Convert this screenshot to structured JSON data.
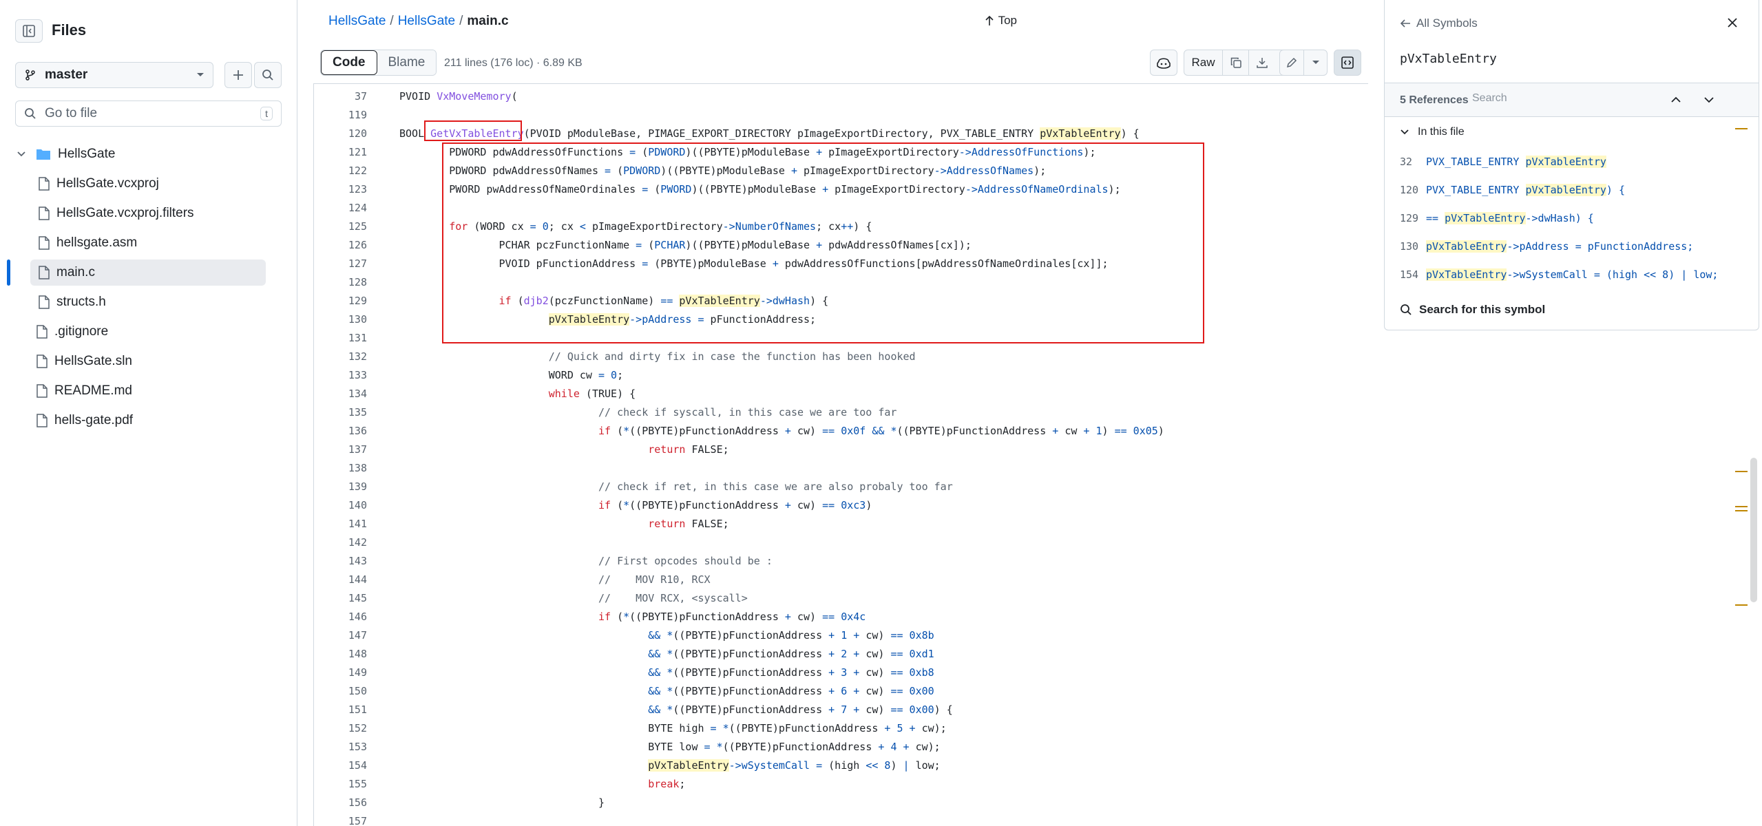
{
  "sidebar": {
    "title": "Files",
    "branch": "master",
    "goto_placeholder": "Go to file",
    "goto_shortcut": "t",
    "tree": [
      {
        "label": "HellsGate",
        "type": "folder"
      },
      {
        "label": "HellsGate.vcxproj",
        "type": "file"
      },
      {
        "label": "HellsGate.vcxproj.filters",
        "type": "file"
      },
      {
        "label": "hellsgate.asm",
        "type": "file"
      },
      {
        "label": "main.c",
        "type": "file"
      },
      {
        "label": "structs.h",
        "type": "file"
      },
      {
        "label": ".gitignore",
        "type": "file"
      },
      {
        "label": "HellsGate.sln",
        "type": "file"
      },
      {
        "label": "README.md",
        "type": "file"
      },
      {
        "label": "hells-gate.pdf",
        "type": "file"
      }
    ]
  },
  "header": {
    "breadcrumb": [
      "HellsGate",
      "HellsGate",
      "main.c"
    ],
    "top_label": "Top"
  },
  "toolbar": {
    "code_tab": "Code",
    "blame_tab": "Blame",
    "file_info": "211 lines (176 loc) · 6.89 KB",
    "raw_label": "Raw"
  },
  "code_lines": [
    {
      "n": "37",
      "html": "PVOID <span class=\"fn\">VxMoveMemory</span>("
    },
    {
      "n": "119",
      "html": ""
    },
    {
      "n": "120",
      "html": "BOOL <span class=\"fn\">GetVxTableEntry</span>(PVOID pModuleBase, PIMAGE_EXPORT_DIRECTORY pImageExportDirectory, PVX_TABLE_ENTRY <span class=\"hl\">pVxTableEntry</span>) {"
    },
    {
      "n": "121",
      "html": "        PDWORD pdwAddressOfFunctions <span class=\"op\">=</span> (<span class=\"ty\">PDWORD</span>)((PBYTE)pModuleBase <span class=\"op\">+</span> pImageExportDirectory<span class=\"op\">-></span><span class=\"ty\">AddressOfFunctions</span>);"
    },
    {
      "n": "122",
      "html": "        PDWORD pdwAddressOfNames <span class=\"op\">=</span> (<span class=\"ty\">PDWORD</span>)((PBYTE)pModuleBase <span class=\"op\">+</span> pImageExportDirectory<span class=\"op\">-></span><span class=\"ty\">AddressOfNames</span>);"
    },
    {
      "n": "123",
      "html": "        PWORD pwAddressOfNameOrdinales <span class=\"op\">=</span> (<span class=\"ty\">PWORD</span>)((PBYTE)pModuleBase <span class=\"op\">+</span> pImageExportDirectory<span class=\"op\">-></span><span class=\"ty\">AddressOfNameOrdinals</span>);"
    },
    {
      "n": "124",
      "html": ""
    },
    {
      "n": "125",
      "html": "        <span class=\"kw\">for</span> (WORD cx <span class=\"op\">=</span> <span class=\"nm\">0</span>; cx <span class=\"op\">&lt;</span> pImageExportDirectory<span class=\"op\">-></span><span class=\"ty\">NumberOfNames</span>; cx<span class=\"op\">++</span>) {"
    },
    {
      "n": "126",
      "html": "                PCHAR pczFunctionName <span class=\"op\">=</span> (<span class=\"ty\">PCHAR</span>)((PBYTE)pModuleBase <span class=\"op\">+</span> pdwAddressOfNames[cx]);"
    },
    {
      "n": "127",
      "html": "                PVOID pFunctionAddress <span class=\"op\">=</span> (PBYTE)pModuleBase <span class=\"op\">+</span> pdwAddressOfFunctions[pwAddressOfNameOrdinales[cx]];"
    },
    {
      "n": "128",
      "html": ""
    },
    {
      "n": "129",
      "html": "                <span class=\"kw\">if</span> (<span class=\"fn\">djb2</span>(pczFunctionName) <span class=\"op\">==</span> <span class=\"hl\">pVxTableEntry</span><span class=\"op\">-></span><span class=\"ty\">dwHash</span>) {"
    },
    {
      "n": "130",
      "html": "                        <span class=\"hl\">pVxTableEntry</span><span class=\"op\">-></span><span class=\"ty\">pAddress</span> <span class=\"op\">=</span> pFunctionAddress;"
    },
    {
      "n": "131",
      "html": ""
    },
    {
      "n": "132",
      "html": "                        <span class=\"cm\">// Quick and dirty fix in case the function has been hooked</span>"
    },
    {
      "n": "133",
      "html": "                        WORD cw <span class=\"op\">=</span> <span class=\"nm\">0</span>;"
    },
    {
      "n": "134",
      "html": "                        <span class=\"kw\">while</span> (TRUE) {"
    },
    {
      "n": "135",
      "html": "                                <span class=\"cm\">// check if syscall, in this case we are too far</span>"
    },
    {
      "n": "136",
      "html": "                                <span class=\"kw\">if</span> (<span class=\"op\">*</span>((PBYTE)pFunctionAddress <span class=\"op\">+</span> cw) <span class=\"op\">==</span> <span class=\"nm\">0x0f</span> <span class=\"op\">&amp;&amp;</span> <span class=\"op\">*</span>((PBYTE)pFunctionAddress <span class=\"op\">+</span> cw <span class=\"op\">+</span> <span class=\"nm\">1</span>) <span class=\"op\">==</span> <span class=\"nm\">0x05</span>)"
    },
    {
      "n": "137",
      "html": "                                        <span class=\"kw\">return</span> FALSE;"
    },
    {
      "n": "138",
      "html": ""
    },
    {
      "n": "139",
      "html": "                                <span class=\"cm\">// check if ret, in this case we are also probaly too far</span>"
    },
    {
      "n": "140",
      "html": "                                <span class=\"kw\">if</span> (<span class=\"op\">*</span>((PBYTE)pFunctionAddress <span class=\"op\">+</span> cw) <span class=\"op\">==</span> <span class=\"nm\">0xc3</span>)"
    },
    {
      "n": "141",
      "html": "                                        <span class=\"kw\">return</span> FALSE;"
    },
    {
      "n": "142",
      "html": ""
    },
    {
      "n": "143",
      "html": "                                <span class=\"cm\">// First opcodes should be :</span>"
    },
    {
      "n": "144",
      "html": "                                <span class=\"cm\">//    MOV R10, RCX</span>"
    },
    {
      "n": "145",
      "html": "                                <span class=\"cm\">//    MOV RCX, &lt;syscall&gt;</span>"
    },
    {
      "n": "146",
      "html": "                                <span class=\"kw\">if</span> (<span class=\"op\">*</span>((PBYTE)pFunctionAddress <span class=\"op\">+</span> cw) <span class=\"op\">==</span> <span class=\"nm\">0x4c</span>"
    },
    {
      "n": "147",
      "html": "                                        <span class=\"op\">&amp;&amp;</span> <span class=\"op\">*</span>((PBYTE)pFunctionAddress <span class=\"op\">+</span> <span class=\"nm\">1</span> <span class=\"op\">+</span> cw) <span class=\"op\">==</span> <span class=\"nm\">0x8b</span>"
    },
    {
      "n": "148",
      "html": "                                        <span class=\"op\">&amp;&amp;</span> <span class=\"op\">*</span>((PBYTE)pFunctionAddress <span class=\"op\">+</span> <span class=\"nm\">2</span> <span class=\"op\">+</span> cw) <span class=\"op\">==</span> <span class=\"nm\">0xd1</span>"
    },
    {
      "n": "149",
      "html": "                                        <span class=\"op\">&amp;&amp;</span> <span class=\"op\">*</span>((PBYTE)pFunctionAddress <span class=\"op\">+</span> <span class=\"nm\">3</span> <span class=\"op\">+</span> cw) <span class=\"op\">==</span> <span class=\"nm\">0xb8</span>"
    },
    {
      "n": "150",
      "html": "                                        <span class=\"op\">&amp;&amp;</span> <span class=\"op\">*</span>((PBYTE)pFunctionAddress <span class=\"op\">+</span> <span class=\"nm\">6</span> <span class=\"op\">+</span> cw) <span class=\"op\">==</span> <span class=\"nm\">0x00</span>"
    },
    {
      "n": "151",
      "html": "                                        <span class=\"op\">&amp;&amp;</span> <span class=\"op\">*</span>((PBYTE)pFunctionAddress <span class=\"op\">+</span> <span class=\"nm\">7</span> <span class=\"op\">+</span> cw) <span class=\"op\">==</span> <span class=\"nm\">0x00</span>) {"
    },
    {
      "n": "152",
      "html": "                                        BYTE high <span class=\"op\">=</span> <span class=\"op\">*</span>((PBYTE)pFunctionAddress <span class=\"op\">+</span> <span class=\"nm\">5</span> <span class=\"op\">+</span> cw);"
    },
    {
      "n": "153",
      "html": "                                        BYTE low <span class=\"op\">=</span> <span class=\"op\">*</span>((PBYTE)pFunctionAddress <span class=\"op\">+</span> <span class=\"nm\">4</span> <span class=\"op\">+</span> cw);"
    },
    {
      "n": "154",
      "html": "                                        <span class=\"hl\">pVxTableEntry</span><span class=\"op\">-></span><span class=\"ty\">wSystemCall</span> <span class=\"op\">=</span> (high <span class=\"op\">&lt;&lt;</span> <span class=\"nm\">8</span>) <span class=\"op\">|</span> low;"
    },
    {
      "n": "155",
      "html": "                                        <span class=\"kw\">break</span>;"
    },
    {
      "n": "156",
      "html": "                                }"
    },
    {
      "n": "157",
      "html": ""
    }
  ],
  "symbols": {
    "back_label": "All Symbols",
    "symbol_name": "pVxTableEntry",
    "ref_count": "5 References",
    "ref_search_placeholder": "Search",
    "in_this_file": "In this file",
    "refs": [
      {
        "line": "32",
        "html": "PVX_TABLE_ENTRY <span class=\"hl\">pVxTableEntry</span>"
      },
      {
        "line": "120",
        "html": "PVX_TABLE_ENTRY <span class=\"hl\">pVxTableEntry</span>) {"
      },
      {
        "line": "129",
        "html": "== <span class=\"hl\">pVxTableEntry</span>->dwHash) {"
      },
      {
        "line": "130",
        "html": "<span class=\"hl\">pVxTableEntry</span>->pAddress = pFunctionAddress;"
      },
      {
        "line": "154",
        "html": "<span class=\"hl\">pVxTableEntry</span>->wSystemCall = (high &lt;&lt; 8) | low;"
      }
    ],
    "search_label": "Search for this symbol"
  },
  "colors": {
    "accent": "#0969da",
    "annotation": "#e01a1a",
    "highlight": "#fff8c5"
  }
}
